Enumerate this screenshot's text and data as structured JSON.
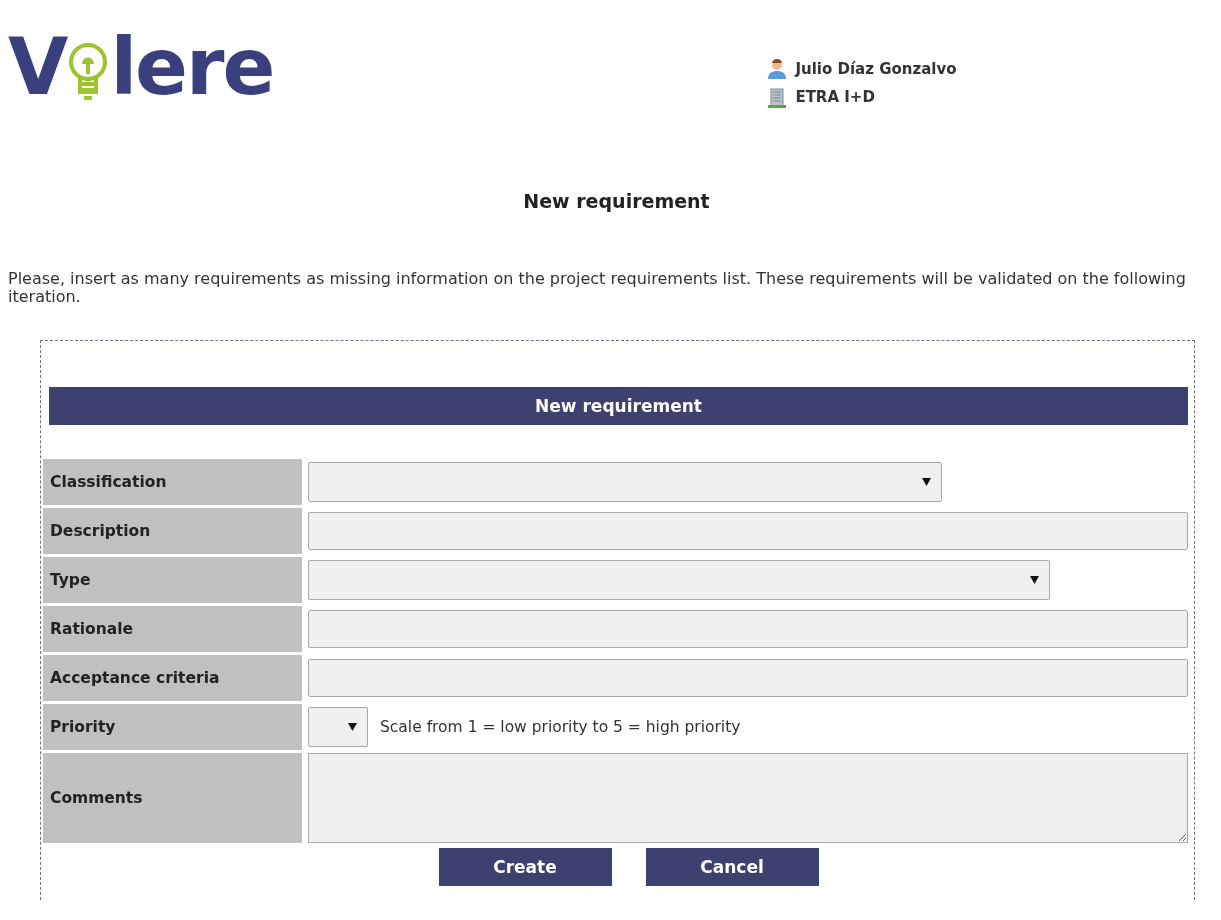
{
  "logo": {
    "parts": [
      "V",
      "lere"
    ]
  },
  "user": {
    "name": "Julio Díaz Gonzalvo",
    "organization": "ETRA I+D"
  },
  "page_title": "New requirement",
  "intro": "Please, insert as many requirements as missing information on the project requirements list. These requirements will be validated on the following iteration.",
  "form": {
    "title": "New requirement",
    "fields": [
      {
        "label": "Classification",
        "kind": "select"
      },
      {
        "label": "Description",
        "kind": "input"
      },
      {
        "label": "Type",
        "kind": "select"
      },
      {
        "label": "Rationale",
        "kind": "input"
      },
      {
        "label": "Acceptance criteria",
        "kind": "input"
      },
      {
        "label": "Priority",
        "kind": "select",
        "hint": "Scale from 1 = low priority to 5 = high priority"
      },
      {
        "label": "Comments",
        "kind": "textarea"
      }
    ],
    "buttons": [
      "Create",
      "Cancel"
    ]
  }
}
